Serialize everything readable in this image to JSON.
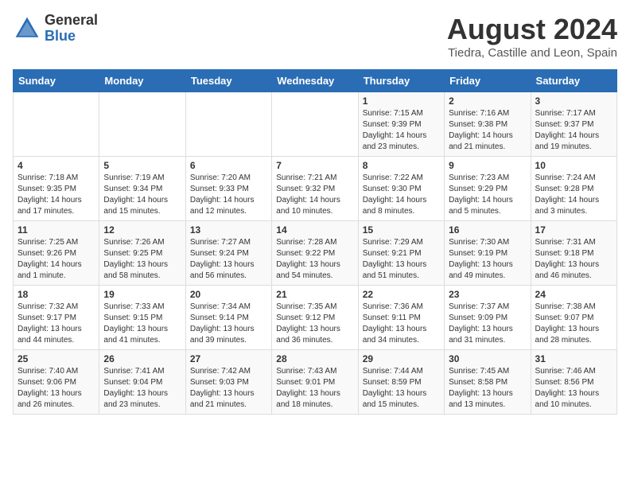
{
  "header": {
    "logo_general": "General",
    "logo_blue": "Blue",
    "title": "August 2024",
    "subtitle": "Tiedra, Castille and Leon, Spain"
  },
  "weekdays": [
    "Sunday",
    "Monday",
    "Tuesday",
    "Wednesday",
    "Thursday",
    "Friday",
    "Saturday"
  ],
  "weeks": [
    [
      {
        "day": "",
        "info": ""
      },
      {
        "day": "",
        "info": ""
      },
      {
        "day": "",
        "info": ""
      },
      {
        "day": "",
        "info": ""
      },
      {
        "day": "1",
        "info": "Sunrise: 7:15 AM\nSunset: 9:39 PM\nDaylight: 14 hours and 23 minutes."
      },
      {
        "day": "2",
        "info": "Sunrise: 7:16 AM\nSunset: 9:38 PM\nDaylight: 14 hours and 21 minutes."
      },
      {
        "day": "3",
        "info": "Sunrise: 7:17 AM\nSunset: 9:37 PM\nDaylight: 14 hours and 19 minutes."
      }
    ],
    [
      {
        "day": "4",
        "info": "Sunrise: 7:18 AM\nSunset: 9:35 PM\nDaylight: 14 hours and 17 minutes."
      },
      {
        "day": "5",
        "info": "Sunrise: 7:19 AM\nSunset: 9:34 PM\nDaylight: 14 hours and 15 minutes."
      },
      {
        "day": "6",
        "info": "Sunrise: 7:20 AM\nSunset: 9:33 PM\nDaylight: 14 hours and 12 minutes."
      },
      {
        "day": "7",
        "info": "Sunrise: 7:21 AM\nSunset: 9:32 PM\nDaylight: 14 hours and 10 minutes."
      },
      {
        "day": "8",
        "info": "Sunrise: 7:22 AM\nSunset: 9:30 PM\nDaylight: 14 hours and 8 minutes."
      },
      {
        "day": "9",
        "info": "Sunrise: 7:23 AM\nSunset: 9:29 PM\nDaylight: 14 hours and 5 minutes."
      },
      {
        "day": "10",
        "info": "Sunrise: 7:24 AM\nSunset: 9:28 PM\nDaylight: 14 hours and 3 minutes."
      }
    ],
    [
      {
        "day": "11",
        "info": "Sunrise: 7:25 AM\nSunset: 9:26 PM\nDaylight: 14 hours and 1 minute."
      },
      {
        "day": "12",
        "info": "Sunrise: 7:26 AM\nSunset: 9:25 PM\nDaylight: 13 hours and 58 minutes."
      },
      {
        "day": "13",
        "info": "Sunrise: 7:27 AM\nSunset: 9:24 PM\nDaylight: 13 hours and 56 minutes."
      },
      {
        "day": "14",
        "info": "Sunrise: 7:28 AM\nSunset: 9:22 PM\nDaylight: 13 hours and 54 minutes."
      },
      {
        "day": "15",
        "info": "Sunrise: 7:29 AM\nSunset: 9:21 PM\nDaylight: 13 hours and 51 minutes."
      },
      {
        "day": "16",
        "info": "Sunrise: 7:30 AM\nSunset: 9:19 PM\nDaylight: 13 hours and 49 minutes."
      },
      {
        "day": "17",
        "info": "Sunrise: 7:31 AM\nSunset: 9:18 PM\nDaylight: 13 hours and 46 minutes."
      }
    ],
    [
      {
        "day": "18",
        "info": "Sunrise: 7:32 AM\nSunset: 9:17 PM\nDaylight: 13 hours and 44 minutes."
      },
      {
        "day": "19",
        "info": "Sunrise: 7:33 AM\nSunset: 9:15 PM\nDaylight: 13 hours and 41 minutes."
      },
      {
        "day": "20",
        "info": "Sunrise: 7:34 AM\nSunset: 9:14 PM\nDaylight: 13 hours and 39 minutes."
      },
      {
        "day": "21",
        "info": "Sunrise: 7:35 AM\nSunset: 9:12 PM\nDaylight: 13 hours and 36 minutes."
      },
      {
        "day": "22",
        "info": "Sunrise: 7:36 AM\nSunset: 9:11 PM\nDaylight: 13 hours and 34 minutes."
      },
      {
        "day": "23",
        "info": "Sunrise: 7:37 AM\nSunset: 9:09 PM\nDaylight: 13 hours and 31 minutes."
      },
      {
        "day": "24",
        "info": "Sunrise: 7:38 AM\nSunset: 9:07 PM\nDaylight: 13 hours and 28 minutes."
      }
    ],
    [
      {
        "day": "25",
        "info": "Sunrise: 7:40 AM\nSunset: 9:06 PM\nDaylight: 13 hours and 26 minutes."
      },
      {
        "day": "26",
        "info": "Sunrise: 7:41 AM\nSunset: 9:04 PM\nDaylight: 13 hours and 23 minutes."
      },
      {
        "day": "27",
        "info": "Sunrise: 7:42 AM\nSunset: 9:03 PM\nDaylight: 13 hours and 21 minutes."
      },
      {
        "day": "28",
        "info": "Sunrise: 7:43 AM\nSunset: 9:01 PM\nDaylight: 13 hours and 18 minutes."
      },
      {
        "day": "29",
        "info": "Sunrise: 7:44 AM\nSunset: 8:59 PM\nDaylight: 13 hours and 15 minutes."
      },
      {
        "day": "30",
        "info": "Sunrise: 7:45 AM\nSunset: 8:58 PM\nDaylight: 13 hours and 13 minutes."
      },
      {
        "day": "31",
        "info": "Sunrise: 7:46 AM\nSunset: 8:56 PM\nDaylight: 13 hours and 10 minutes."
      }
    ]
  ]
}
